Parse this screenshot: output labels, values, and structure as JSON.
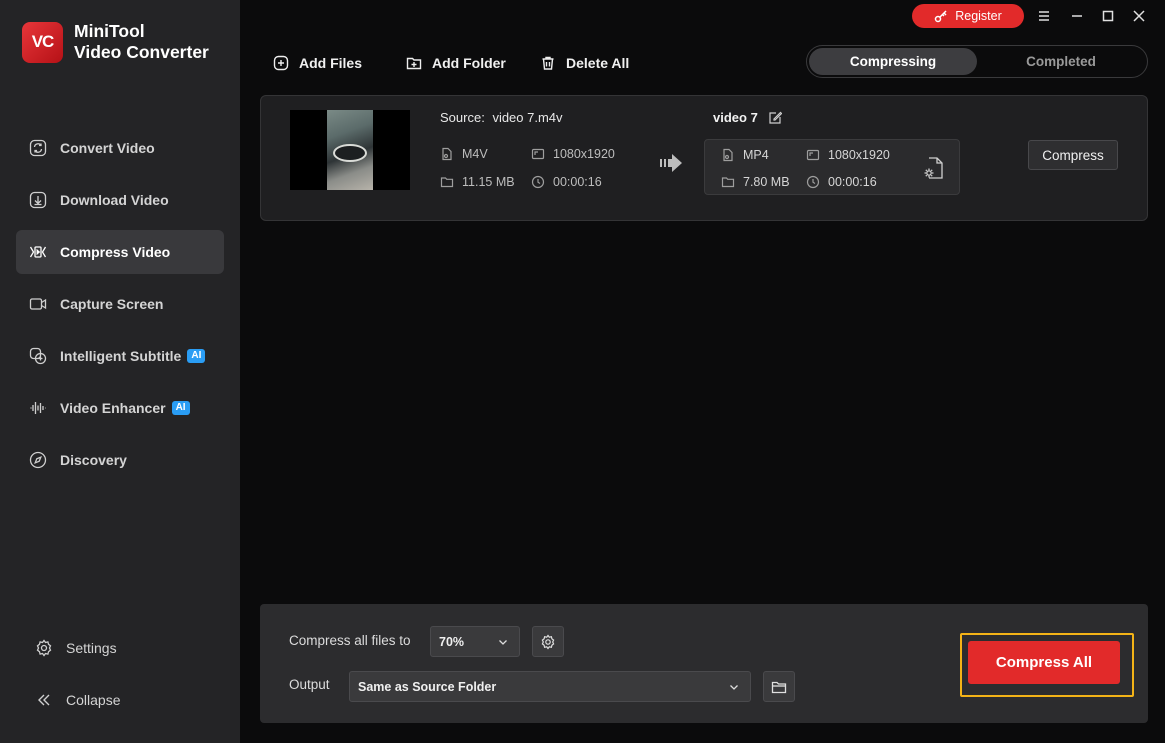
{
  "app": {
    "logo_letters": "VC",
    "title_line1": "MiniTool",
    "title_line2": "Video Converter"
  },
  "titlebar": {
    "register_label": "Register"
  },
  "sidebar": {
    "items": [
      {
        "label": "Convert Video",
        "icon": "convert-icon"
      },
      {
        "label": "Download Video",
        "icon": "download-icon"
      },
      {
        "label": "Compress Video",
        "icon": "compress-icon",
        "active": true
      },
      {
        "label": "Capture Screen",
        "icon": "camera-icon"
      },
      {
        "label": "Intelligent Subtitle",
        "icon": "subtitle-icon",
        "badge": "AI"
      },
      {
        "label": "Video Enhancer",
        "icon": "waveform-icon",
        "badge": "AI"
      },
      {
        "label": "Discovery",
        "icon": "compass-icon"
      }
    ],
    "settings_label": "Settings",
    "collapse_label": "Collapse"
  },
  "toolbar": {
    "add_files": "Add Files",
    "add_folder": "Add Folder",
    "delete_all": "Delete All"
  },
  "tabs": {
    "compressing": "Compressing",
    "completed": "Completed"
  },
  "file": {
    "source_label": "Source:",
    "source_name": "video 7.m4v",
    "src_format": "M4V",
    "src_resolution": "1080x1920",
    "src_size": "11.15 MB",
    "src_duration": "00:00:16",
    "output_name": "video 7",
    "out_format": "MP4",
    "out_resolution": "1080x1920",
    "out_size": "7.80 MB",
    "out_duration": "00:00:16",
    "compress_label": "Compress"
  },
  "bottom": {
    "compress_all_to_label": "Compress all files to",
    "ratio": "70%",
    "output_label": "Output",
    "output_value": "Same as Source Folder",
    "compress_all_label": "Compress All"
  },
  "colors": {
    "accent_red": "#e22a2a",
    "highlight_yellow": "#f3b317",
    "ai_badge_blue": "#2a9df4"
  }
}
